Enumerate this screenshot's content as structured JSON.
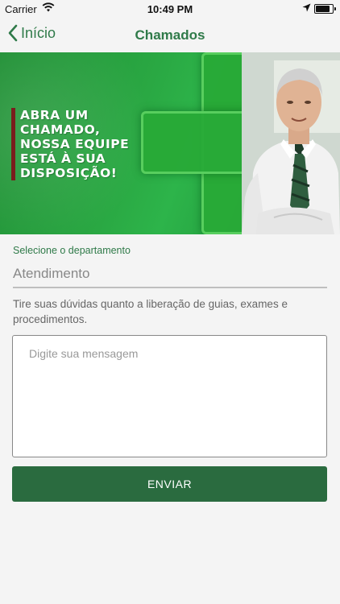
{
  "status_bar": {
    "carrier": "Carrier",
    "time": "10:49 PM",
    "battery_level": 0.75
  },
  "nav": {
    "back_label": "Início",
    "title": "Chamados"
  },
  "banner": {
    "lines": [
      "ABRA UM",
      "CHAMADO,",
      "NOSSA EQUIPE",
      "ESTÁ À SUA",
      "DISPOSIÇÃO!"
    ]
  },
  "form": {
    "department_label": "Selecione o departamento",
    "department_value": "Atendimento",
    "description": "Tire suas dúvidas quanto a liberação de guias, exames e procedimentos.",
    "message_placeholder": "Digite sua mensagem",
    "send_label": "ENVIAR"
  },
  "colors": {
    "accent": "#2f7a49",
    "button": "#2a6b3f",
    "banner_green": "#2aa843"
  },
  "icons": [
    "wifi-icon",
    "location-arrow-icon",
    "battery-icon",
    "chevron-left-icon"
  ]
}
